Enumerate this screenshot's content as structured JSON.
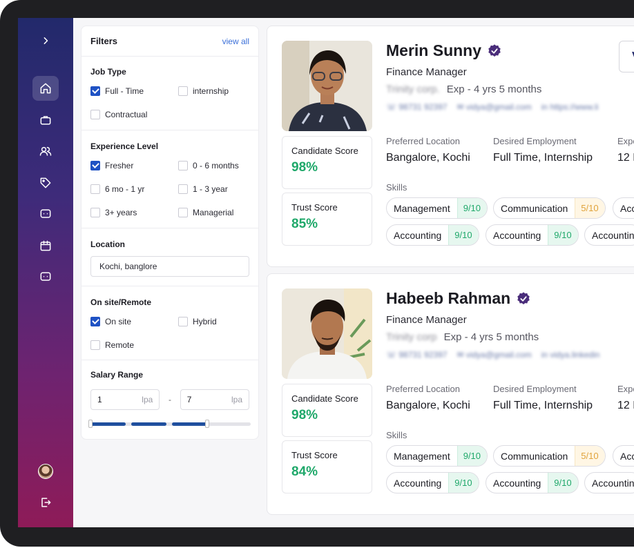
{
  "sidebar": {
    "items": [
      {
        "icon": "chevron-right-icon"
      },
      {
        "icon": "home-icon",
        "active": true
      },
      {
        "icon": "briefcase-icon"
      },
      {
        "icon": "users-icon"
      },
      {
        "icon": "tag-icon"
      },
      {
        "icon": "message-icon"
      },
      {
        "icon": "calendar-icon"
      },
      {
        "icon": "chat-icon"
      },
      {
        "icon": "logout-icon"
      }
    ]
  },
  "filters": {
    "title": "Filters",
    "view_all": "view all",
    "job_type": {
      "label": "Job Type",
      "options": [
        {
          "label": "Full - Time",
          "checked": true
        },
        {
          "label": "internship",
          "checked": false
        },
        {
          "label": "Contractual",
          "checked": false
        }
      ]
    },
    "experience": {
      "label": "Experience Level",
      "options": [
        {
          "label": "Fresher",
          "checked": true
        },
        {
          "label": "0 - 6 months",
          "checked": false
        },
        {
          "label": "6 mo - 1 yr",
          "checked": false
        },
        {
          "label": "1 - 3 year",
          "checked": false
        },
        {
          "label": "3+ years",
          "checked": false
        },
        {
          "label": "Managerial",
          "checked": false
        }
      ]
    },
    "location": {
      "label": "Location",
      "value": "Kochi, banglore"
    },
    "onsite": {
      "label": "On site/Remote",
      "options": [
        {
          "label": "On site",
          "checked": true
        },
        {
          "label": "Hybrid",
          "checked": false
        },
        {
          "label": "Remote",
          "checked": false
        }
      ]
    },
    "salary": {
      "label": "Salary Range",
      "min": "1",
      "max": "7",
      "unit": "lpa",
      "separator": "-",
      "range_fraction": [
        0.0,
        0.73
      ]
    }
  },
  "candidates": [
    {
      "name": "Merin Sunny",
      "role": "Finance Manager",
      "company": "Trinity corp.",
      "experience": "Exp - 4 yrs 5 months",
      "phone": "98731 92397",
      "email": "vidya@gmail.com",
      "link": "https://www.li",
      "candidate_score_label": "Candidate Score",
      "candidate_score": "98%",
      "trust_score_label": "Trust Score",
      "trust_score": "85%",
      "preferred_location_label": "Preferred Location",
      "preferred_location": "Bangalore, Kochi",
      "desired_employment_label": "Desired Employment",
      "desired_employment": "Full Time, Internship",
      "expected_label": "Expe",
      "expected_value": "12 L",
      "skills_label": "Skills",
      "skills": [
        {
          "name": "Management",
          "score": "9/10",
          "level": "good"
        },
        {
          "name": "Communication",
          "score": "5/10",
          "level": "mid"
        },
        {
          "name": "Acc",
          "score": "",
          "level": "good"
        },
        {
          "name": "Accounting",
          "score": "9/10",
          "level": "good"
        },
        {
          "name": "Accounting",
          "score": "9/10",
          "level": "good"
        },
        {
          "name": "Accountin",
          "score": "",
          "level": "good"
        }
      ],
      "button_label": "V"
    },
    {
      "name": "Habeeb Rahman",
      "role": "Finance Manager",
      "company": "Trinity corp",
      "experience": "Exp - 4 yrs 5 months",
      "phone": "98731 92397",
      "email": "vidya@gmail.com",
      "link": "vidya.linkedin",
      "candidate_score_label": "Candidate Score",
      "candidate_score": "98%",
      "trust_score_label": "Trust Score",
      "trust_score": "84%",
      "preferred_location_label": "Preferred Location",
      "preferred_location": "Bangalore, Kochi",
      "desired_employment_label": "Desired Employment",
      "desired_employment": "Full Time, Internship",
      "expected_label": "Expe",
      "expected_value": "12 L",
      "skills_label": "Skills",
      "skills": [
        {
          "name": "Management",
          "score": "9/10",
          "level": "good"
        },
        {
          "name": "Communication",
          "score": "5/10",
          "level": "mid"
        },
        {
          "name": "Acc",
          "score": "",
          "level": "good"
        },
        {
          "name": "Accounting",
          "score": "9/10",
          "level": "good"
        },
        {
          "name": "Accounting",
          "score": "9/10",
          "level": "good"
        },
        {
          "name": "Accountin",
          "score": "",
          "level": "good"
        }
      ]
    }
  ],
  "colors": {
    "accent": "#1f52c4",
    "score_green": "#1fa86a",
    "score_amber": "#e0a23a",
    "sidebar_top": "#22296b",
    "sidebar_bottom": "#8e1b58"
  }
}
